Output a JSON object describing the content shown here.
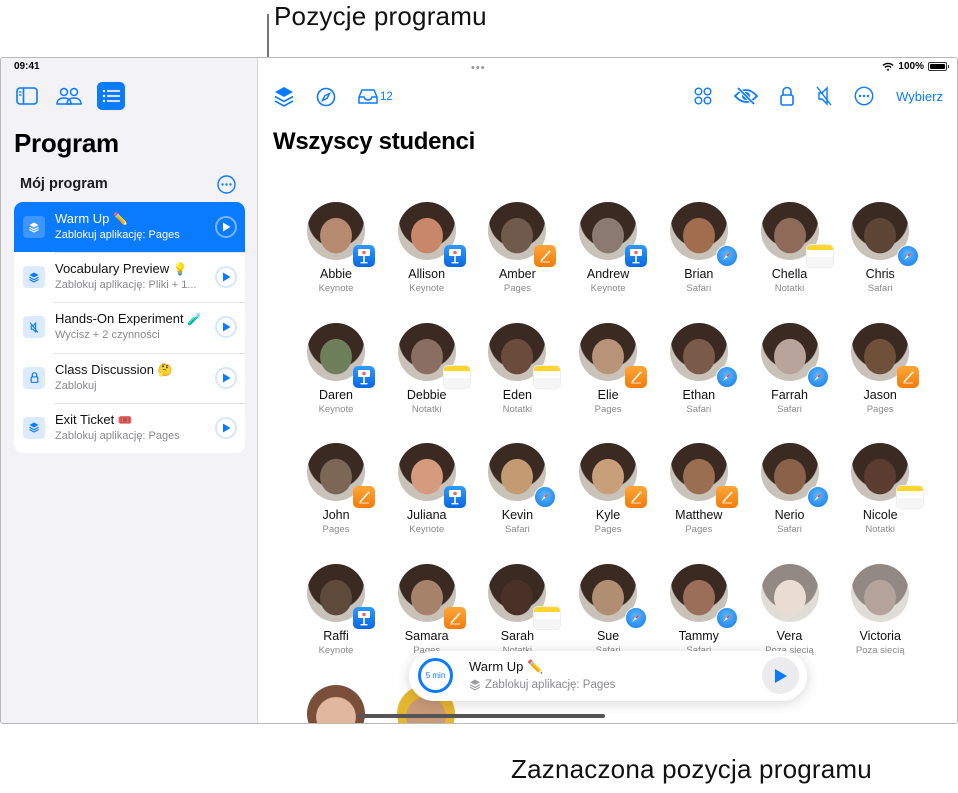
{
  "callouts": {
    "top": "Pozycje programu",
    "bottom": "Zaznaczona pozycja programu"
  },
  "status_bar": {
    "time": "09:41",
    "battery": "100%",
    "battery_level": 1.0
  },
  "sidebar": {
    "icons": [
      "sidebar-icon",
      "students-icon",
      "list-icon"
    ],
    "title": "Program",
    "section": "Mój program",
    "items": [
      {
        "title": "Warm Up",
        "emoji": "✏️",
        "subtitle": "Zablokuj aplikację: Pages",
        "icon": "layers-icon",
        "selected": true
      },
      {
        "title": "Vocabulary Preview",
        "emoji": "💡",
        "subtitle": "Zablokuj aplikację: Pliki + 1...",
        "icon": "layers-icon",
        "selected": false
      },
      {
        "title": "Hands-On Experiment",
        "emoji": "🧪",
        "subtitle": "Wycisz + 2 czynności",
        "icon": "mute-icon",
        "selected": false
      },
      {
        "title": "Class Discussion",
        "emoji": "🤔",
        "subtitle": "Zablokuj",
        "icon": "lock-icon",
        "selected": false
      },
      {
        "title": "Exit Ticket",
        "emoji": "🎟️",
        "subtitle": "Zablokuj aplikację: Pages",
        "icon": "layers-icon",
        "selected": false
      }
    ]
  },
  "toolbar": {
    "inbox_count": "12",
    "select_label": "Wybierz"
  },
  "main": {
    "title": "Wszyscy studenci",
    "students": [
      {
        "name": "Abbie",
        "app": "Keynote",
        "badge": "keynote",
        "color": "#b58a6e"
      },
      {
        "name": "Allison",
        "app": "Keynote",
        "badge": "keynote",
        "color": "#c9876a"
      },
      {
        "name": "Amber",
        "app": "Pages",
        "badge": "pages",
        "color": "#6f5a4c"
      },
      {
        "name": "Andrew",
        "app": "Keynote",
        "badge": "keynote",
        "color": "#8b7a70"
      },
      {
        "name": "Brian",
        "app": "Safari",
        "badge": "safari",
        "color": "#a06d4e"
      },
      {
        "name": "Chella",
        "app": "Notatki",
        "badge": "notes",
        "color": "#8e6a58"
      },
      {
        "name": "Chris",
        "app": "Safari",
        "badge": "safari",
        "color": "#5d4636"
      },
      {
        "name": "Daren",
        "app": "Keynote",
        "badge": "keynote",
        "color": "#6d7f5a"
      },
      {
        "name": "Debbie",
        "app": "Notatki",
        "badge": "notes",
        "color": "#8a6e62"
      },
      {
        "name": "Eden",
        "app": "Notatki",
        "badge": "notes",
        "color": "#6b4c3c"
      },
      {
        "name": "Elie",
        "app": "Pages",
        "badge": "pages",
        "color": "#b79378"
      },
      {
        "name": "Ethan",
        "app": "Safari",
        "badge": "safari",
        "color": "#7a5a48"
      },
      {
        "name": "Farrah",
        "app": "Safari",
        "badge": "safari",
        "color": "#b8a49a"
      },
      {
        "name": "Jason",
        "app": "Pages",
        "badge": "pages",
        "color": "#6f5038"
      },
      {
        "name": "John",
        "app": "Pages",
        "badge": "pages",
        "color": "#7c6656"
      },
      {
        "name": "Juliana",
        "app": "Keynote",
        "badge": "keynote",
        "color": "#d59b7e"
      },
      {
        "name": "Kevin",
        "app": "Safari",
        "badge": "safari",
        "color": "#c49a72"
      },
      {
        "name": "Kyle",
        "app": "Pages",
        "badge": "pages",
        "color": "#c7a07a"
      },
      {
        "name": "Matthew",
        "app": "Pages",
        "badge": "pages",
        "color": "#9a6e50"
      },
      {
        "name": "Nerio",
        "app": "Safari",
        "badge": "safari",
        "color": "#8a624a"
      },
      {
        "name": "Nicole",
        "app": "Notatki",
        "badge": "notes",
        "color": "#5a3c30"
      },
      {
        "name": "Raffi",
        "app": "Keynote",
        "badge": "keynote",
        "color": "#5e4a3a"
      },
      {
        "name": "Samara",
        "app": "Pages",
        "badge": "pages",
        "color": "#a7826a"
      },
      {
        "name": "Sarah",
        "app": "Notatki",
        "badge": "notes",
        "color": "#4a3128"
      },
      {
        "name": "Sue",
        "app": "Safari",
        "badge": "safari",
        "color": "#b08e72"
      },
      {
        "name": "Tammy",
        "app": "Safari",
        "badge": "safari",
        "color": "#9a6e58"
      },
      {
        "name": "Vera",
        "app": "Poza siecią",
        "badge": "none",
        "color": "#d8c2b0",
        "offline": true
      },
      {
        "name": "Victoria",
        "app": "Poza siecią",
        "badge": "none",
        "color": "#7a5a4a",
        "offline": true
      }
    ]
  },
  "now_playing": {
    "timer": "5 min",
    "title": "Warm Up ✏️",
    "subtitle": "Zablokuj aplikację: Pages"
  }
}
